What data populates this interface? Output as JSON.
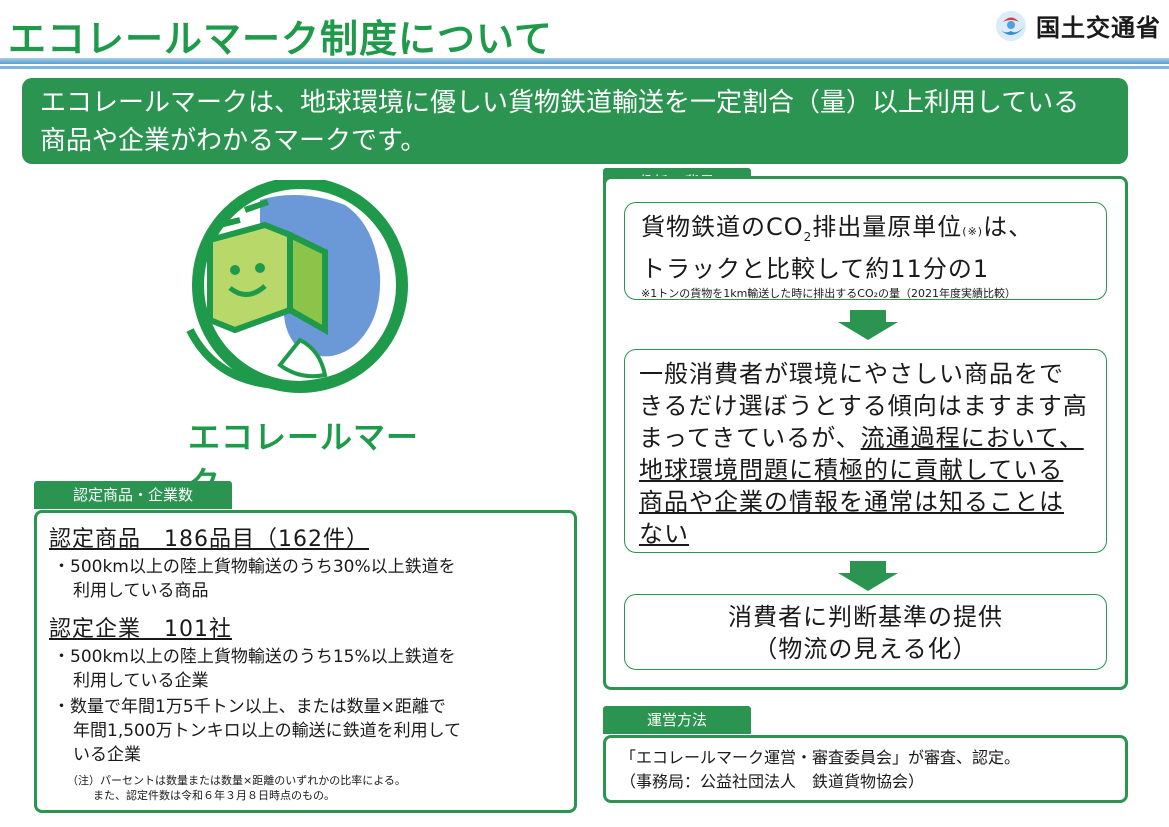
{
  "header": {
    "title": "エコレールマーク制度について",
    "ministry": "国土交通省"
  },
  "banner": {
    "line1": "エコレールマークは、地球環境に優しい貨物鉄道輸送を一定割合（量）以上利用している",
    "line2": "商品や企業がわかるマークです。"
  },
  "logo": {
    "text": "エコレールマーク"
  },
  "certified": {
    "tab": "認定商品・企業数",
    "products_heading": "認定商品　186品目（162件）",
    "products_bullet1_l1": "・500km以上の陸上貨物輸送のうち30%以上鉄道を",
    "products_bullet1_l2": "利用している商品",
    "companies_heading": "認定企業　101社",
    "companies_bullet1_l1": "・500km以上の陸上貨物輸送のうち15%以上鉄道を",
    "companies_bullet1_l2": "利用している企業",
    "companies_bullet2_l1": "・数量で年間1万5千トン以上、または数量×距離で",
    "companies_bullet2_l2": "年間1,500万トンキロ以上の輸送に鉄道を利用して",
    "companies_bullet2_l3": "いる企業",
    "note1": "（注）パーセントは数量または数量×距離のいずれかの比率による。",
    "note2": "また、認定件数は令和６年３月８日時点のもの。"
  },
  "purpose": {
    "tab": "趣旨・背景",
    "box1_line1_a": "貨物鉄道のCO",
    "box1_line1_sub": "2",
    "box1_line1_b": "排出量原単位",
    "box1_line1_mark": "(※)",
    "box1_line1_c": "は、",
    "box1_line2": "トラックと比較して約11分の1",
    "box1_note": "※1トンの貨物を1km輸送した時に排出するCO₂の量（2021年度実績比較）",
    "box2_line1": "一般消費者が環境にやさしい商品をで",
    "box2_line2": "きるだけ選ぼうとする傾向はますます高",
    "box2_line3_a": "まってきているが、",
    "box2_line3_b": "流通過程において、",
    "box2_line4": "地球環境問題に積極的に貢献している",
    "box2_line5": "商品や企業の情報を通常は知ることは",
    "box2_line6": "ない",
    "box3_line1": "消費者に判断基準の提供",
    "box3_line2": "（物流の見える化）"
  },
  "operation": {
    "tab": "運営方法",
    "line1": "「エコレールマーク運営・審査委員会」が審査、認定。",
    "line2": "（事務局：公益社団法人　鉄道貨物協会）"
  },
  "colors": {
    "green": "#2a9450",
    "title_green": "#1f9a4a",
    "rule_blue": "#5aa0d2"
  },
  "icons": {
    "ministry_logo": "mlit-logo-icon",
    "ecorail_mark": "ecorail-mark-icon",
    "down_arrow": "down-arrow-icon"
  }
}
